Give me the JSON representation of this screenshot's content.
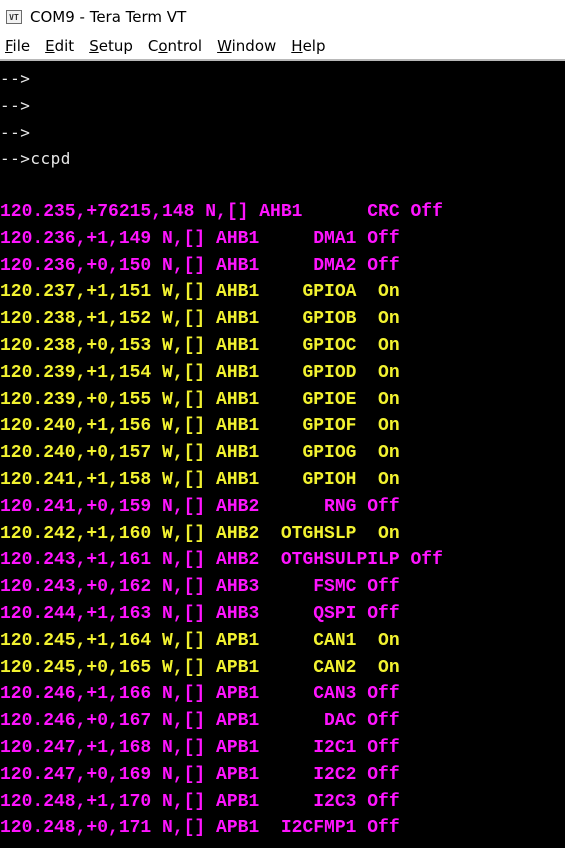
{
  "window": {
    "title": "COM9 - Tera Term VT",
    "icon": "VT"
  },
  "menu": [
    {
      "key": "F",
      "rest": "ile"
    },
    {
      "key": "E",
      "rest": "dit"
    },
    {
      "key": "S",
      "rest": "etup"
    },
    {
      "key": "C",
      "pre": "",
      "rest": "ontrol",
      "under": "o"
    },
    {
      "key": "W",
      "rest": "indow"
    },
    {
      "key": "H",
      "rest": "elp"
    }
  ],
  "menu_labels": [
    "File",
    "Edit",
    "Setup",
    "Control",
    "Window",
    "Help"
  ],
  "colors": {
    "magenta": "#ff14ff",
    "yellow": "#f2f230",
    "background": "#000000",
    "prompt": "#e8e8e8"
  },
  "terminal": {
    "prompts": [
      "-->",
      "-->",
      "-->",
      "-->ccpd"
    ],
    "log": [
      {
        "text": "120.235,+76215,148 N,[] AHB1      CRC Off",
        "color": "magenta"
      },
      {
        "text": "120.236,+1,149 N,[] AHB1     DMA1 Off",
        "color": "magenta"
      },
      {
        "text": "120.236,+0,150 N,[] AHB1     DMA2 Off",
        "color": "magenta"
      },
      {
        "text": "120.237,+1,151 W,[] AHB1    GPIOA  On",
        "color": "yellow"
      },
      {
        "text": "120.238,+1,152 W,[] AHB1    GPIOB  On",
        "color": "yellow"
      },
      {
        "text": "120.238,+0,153 W,[] AHB1    GPIOC  On",
        "color": "yellow"
      },
      {
        "text": "120.239,+1,154 W,[] AHB1    GPIOD  On",
        "color": "yellow"
      },
      {
        "text": "120.239,+0,155 W,[] AHB1    GPIOE  On",
        "color": "yellow"
      },
      {
        "text": "120.240,+1,156 W,[] AHB1    GPIOF  On",
        "color": "yellow"
      },
      {
        "text": "120.240,+0,157 W,[] AHB1    GPIOG  On",
        "color": "yellow"
      },
      {
        "text": "120.241,+1,158 W,[] AHB1    GPIOH  On",
        "color": "yellow"
      },
      {
        "text": "120.241,+0,159 N,[] AHB2      RNG Off",
        "color": "magenta"
      },
      {
        "text": "120.242,+1,160 W,[] AHB2  OTGHSLP  On",
        "color": "yellow"
      },
      {
        "text": "120.243,+1,161 N,[] AHB2  OTGHSULPILP Off",
        "color": "magenta"
      },
      {
        "text": "120.243,+0,162 N,[] AHB3     FSMC Off",
        "color": "magenta"
      },
      {
        "text": "120.244,+1,163 N,[] AHB3     QSPI Off",
        "color": "magenta"
      },
      {
        "text": "120.245,+1,164 W,[] APB1     CAN1  On",
        "color": "yellow"
      },
      {
        "text": "120.245,+0,165 W,[] APB1     CAN2  On",
        "color": "yellow"
      },
      {
        "text": "120.246,+1,166 N,[] APB1     CAN3 Off",
        "color": "magenta"
      },
      {
        "text": "120.246,+0,167 N,[] APB1      DAC Off",
        "color": "magenta"
      },
      {
        "text": "120.247,+1,168 N,[] APB1     I2C1 Off",
        "color": "magenta"
      },
      {
        "text": "120.247,+0,169 N,[] APB1     I2C2 Off",
        "color": "magenta"
      },
      {
        "text": "120.248,+1,170 N,[] APB1     I2C3 Off",
        "color": "magenta"
      },
      {
        "text": "120.248,+0,171 N,[] APB1  I2CFMP1 Off",
        "color": "magenta"
      }
    ]
  }
}
